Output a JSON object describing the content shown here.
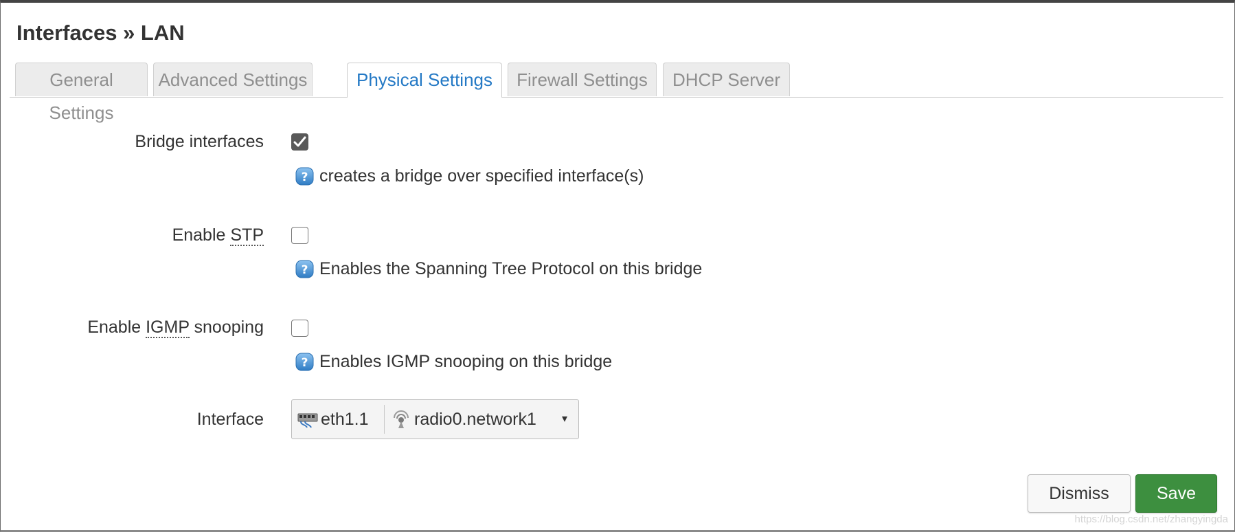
{
  "page": {
    "title": "Interfaces » LAN"
  },
  "tabs": [
    {
      "label": "General Settings",
      "active": false
    },
    {
      "label": "Advanced Settings",
      "active": false
    },
    {
      "label": "Physical Settings",
      "active": true
    },
    {
      "label": "Firewall Settings",
      "active": false
    },
    {
      "label": "DHCP Server",
      "active": false
    }
  ],
  "form": {
    "bridge": {
      "label": "Bridge interfaces",
      "checked": true,
      "help": "creates a bridge over specified interface(s)"
    },
    "stp": {
      "label_prefix": "Enable ",
      "label_abbr": "STP",
      "checked": false,
      "help": "Enables the Spanning Tree Protocol on this bridge"
    },
    "igmp": {
      "label_prefix": "Enable ",
      "label_abbr": "IGMP",
      "label_suffix": " snooping",
      "checked": false,
      "help": "Enables IGMP snooping on this bridge"
    },
    "interface": {
      "label": "Interface",
      "selected": [
        {
          "name": "eth1.1",
          "icon": "ethernet-switch-icon"
        },
        {
          "name": "radio0.network1",
          "icon": "wifi-icon"
        }
      ],
      "caret": "▾"
    }
  },
  "actions": {
    "dismiss_label": "Dismiss",
    "save_label": "Save"
  },
  "watermark": "https://blog.csdn.net/zhangyingda",
  "colors": {
    "active_tab": "#2479c5",
    "save_button": "#3d8f3f",
    "help_icon": "#4a90d9",
    "checkbox_checked": "#595959"
  }
}
